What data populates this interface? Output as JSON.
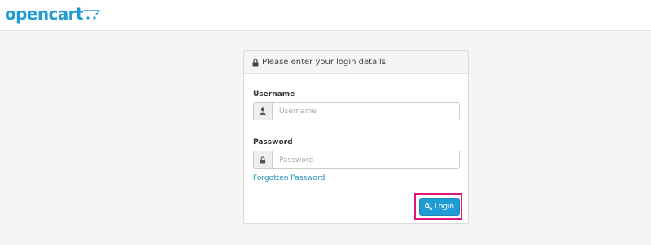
{
  "header": {
    "brand": "opencart",
    "brand_color": "#1f9bd6"
  },
  "panel": {
    "heading": "Please enter your login details.",
    "username": {
      "label": "Username",
      "placeholder": "Username",
      "value": "",
      "icon": "user-icon"
    },
    "password": {
      "label": "Password",
      "placeholder": "Password",
      "value": "",
      "icon": "lock-icon"
    },
    "forgot_link": "Forgotten Password",
    "login_button": "Login",
    "login_icon": "key-icon",
    "highlight_color": "#e0177b"
  }
}
